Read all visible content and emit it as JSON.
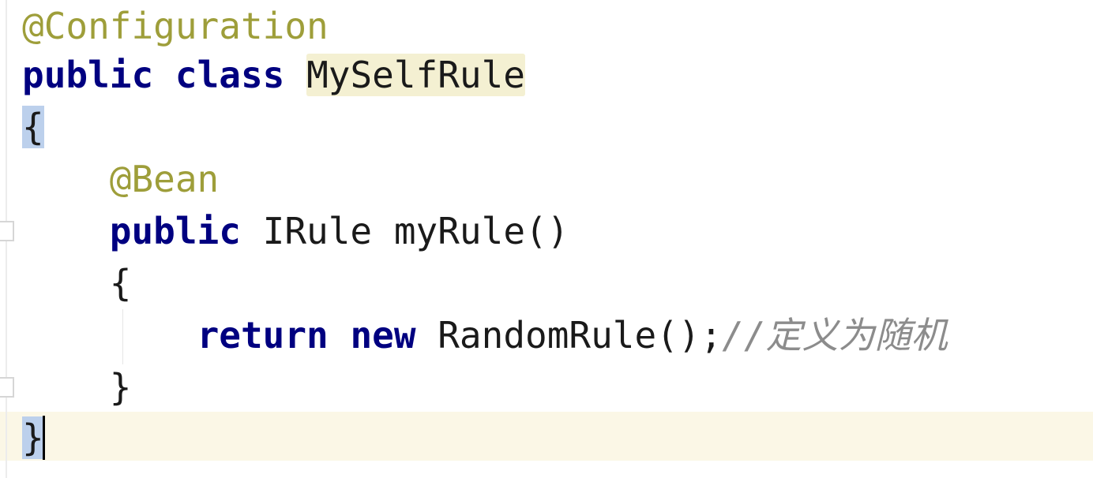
{
  "code": {
    "line1": {
      "annotation": "@Configuration"
    },
    "line2": {
      "kw_public": "public",
      "kw_class": "class",
      "class_name": "MySelfRule"
    },
    "line3": {
      "brace": "{"
    },
    "line4": {
      "annotation": "@Bean"
    },
    "line5": {
      "kw_public": "public",
      "return_type": "IRule",
      "method": "myRule()"
    },
    "line6": {
      "brace": "{"
    },
    "line7": {
      "kw_return": "return",
      "kw_new": "new",
      "call": "RandomRule();",
      "comment": "//定义为随机"
    },
    "line8": {
      "brace": "}"
    },
    "line9": {
      "brace": "}"
    }
  },
  "colors": {
    "annotation": "#9e9e3a",
    "keyword": "#000080",
    "comment": "#8c8c8c",
    "current_line": "#fbf7e6",
    "brace_match": "#bcd0ec"
  }
}
